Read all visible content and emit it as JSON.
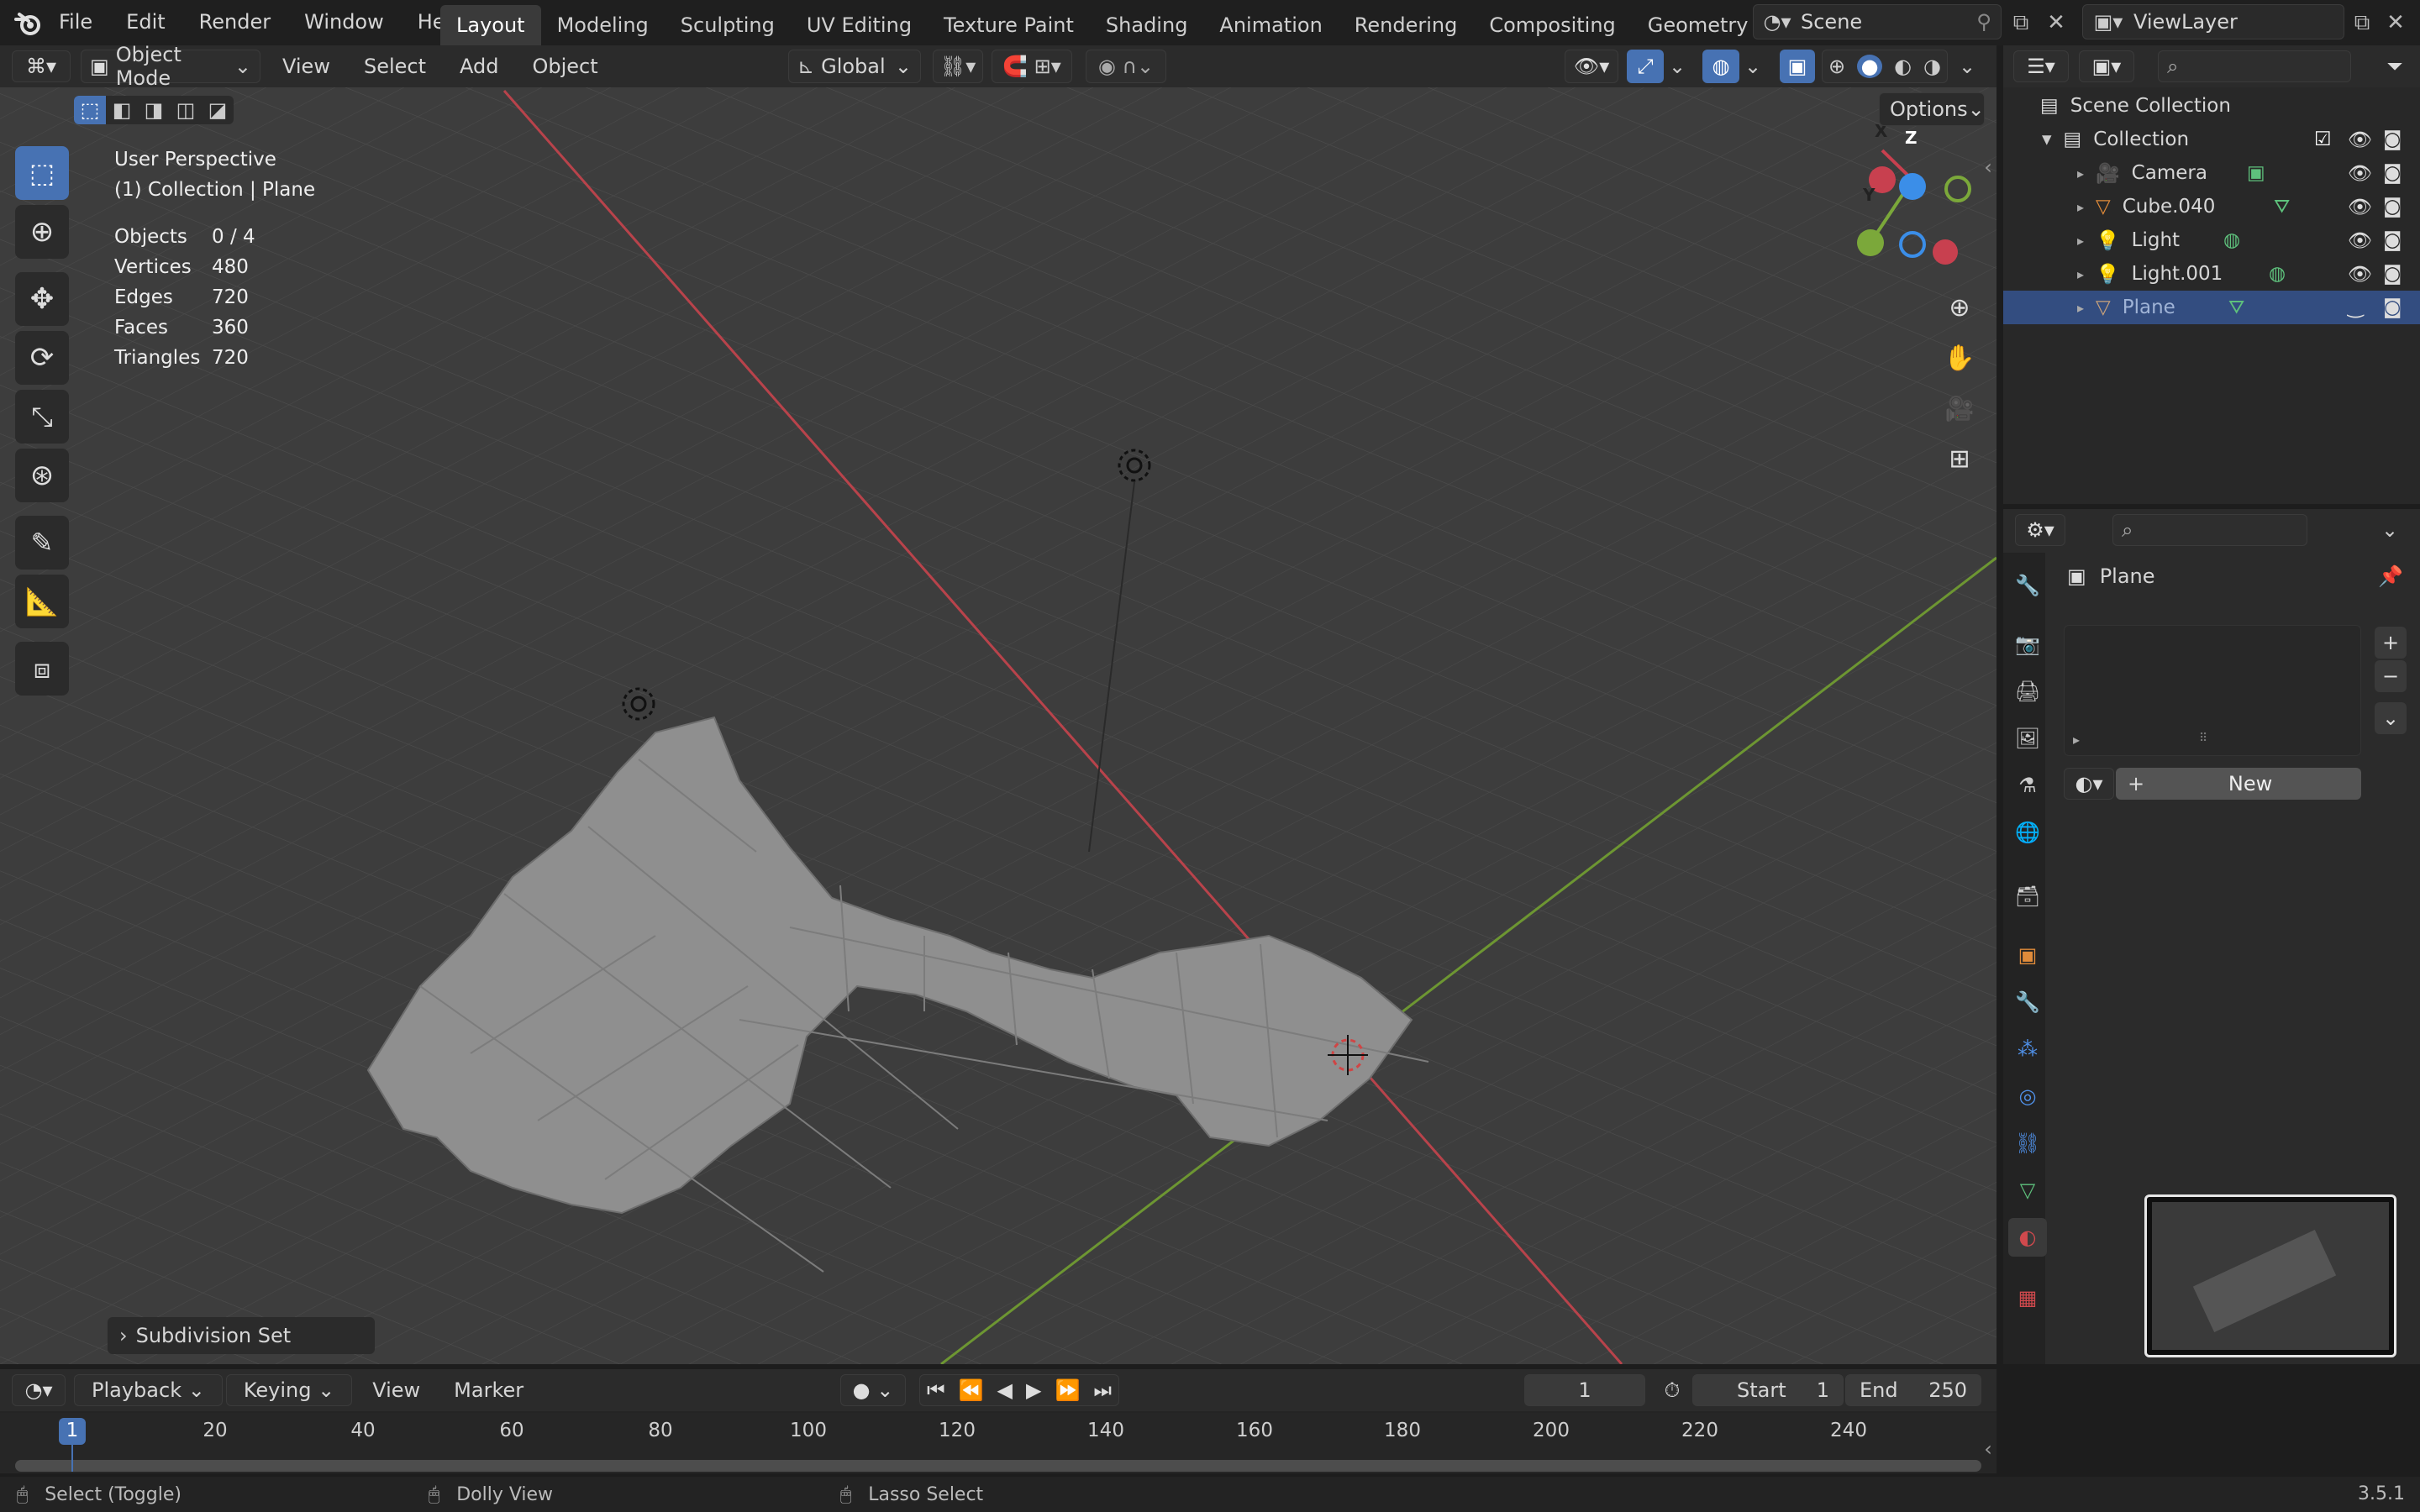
{
  "topbar": {
    "menus": [
      "File",
      "Edit",
      "Render",
      "Window",
      "Help"
    ],
    "workspaces": [
      "Layout",
      "Modeling",
      "Sculpting",
      "UV Editing",
      "Texture Paint",
      "Shading",
      "Animation",
      "Rendering",
      "Compositing",
      "Geometry Nodes"
    ],
    "active_workspace": "Layout",
    "scene": "Scene",
    "view_layer": "ViewLayer"
  },
  "viewport_header": {
    "mode": "Object Mode",
    "menus": [
      "View",
      "Select",
      "Add",
      "Object"
    ],
    "transform_orientation": "Global",
    "options": "Options"
  },
  "viewport": {
    "perspective": "User Perspective",
    "collection_path": "(1) Collection | Plane",
    "stats": [
      {
        "label": "Objects",
        "value": "0 / 4"
      },
      {
        "label": "Vertices",
        "value": "480"
      },
      {
        "label": "Edges",
        "value": "720"
      },
      {
        "label": "Faces",
        "value": "360"
      },
      {
        "label": "Triangles",
        "value": "720"
      }
    ],
    "last_operator": "Subdivision Set",
    "gizmo_axes": [
      "X",
      "Y",
      "Z"
    ]
  },
  "outliner": {
    "root": "Scene Collection",
    "collection": "Collection",
    "items": [
      {
        "name": "Camera",
        "type": "camera-icon"
      },
      {
        "name": "Cube.040",
        "type": "mesh-icon"
      },
      {
        "name": "Light",
        "type": "light-icon"
      },
      {
        "name": "Light.001",
        "type": "light-icon"
      },
      {
        "name": "Plane",
        "type": "mesh-icon"
      }
    ],
    "selected": "Plane"
  },
  "properties": {
    "object_name": "Plane",
    "new_button": "New"
  },
  "timeline": {
    "menus": [
      "Playback",
      "Keying",
      "View",
      "Marker"
    ],
    "current_frame": "1",
    "start_label": "Start",
    "start": "1",
    "end_label": "End",
    "end": "250",
    "ticks": [
      "1",
      "20",
      "40",
      "60",
      "80",
      "100",
      "120",
      "140",
      "160",
      "180",
      "200",
      "220",
      "240"
    ]
  },
  "statusbar": {
    "hints": [
      "Select (Toggle)",
      "Dolly View",
      "Lasso Select"
    ],
    "version": "3.5.1"
  },
  "colors": {
    "accent": "#4772b3",
    "x_axis": "#c8404f",
    "y_axis": "#7ba83a",
    "z_axis": "#3b8ee8"
  }
}
